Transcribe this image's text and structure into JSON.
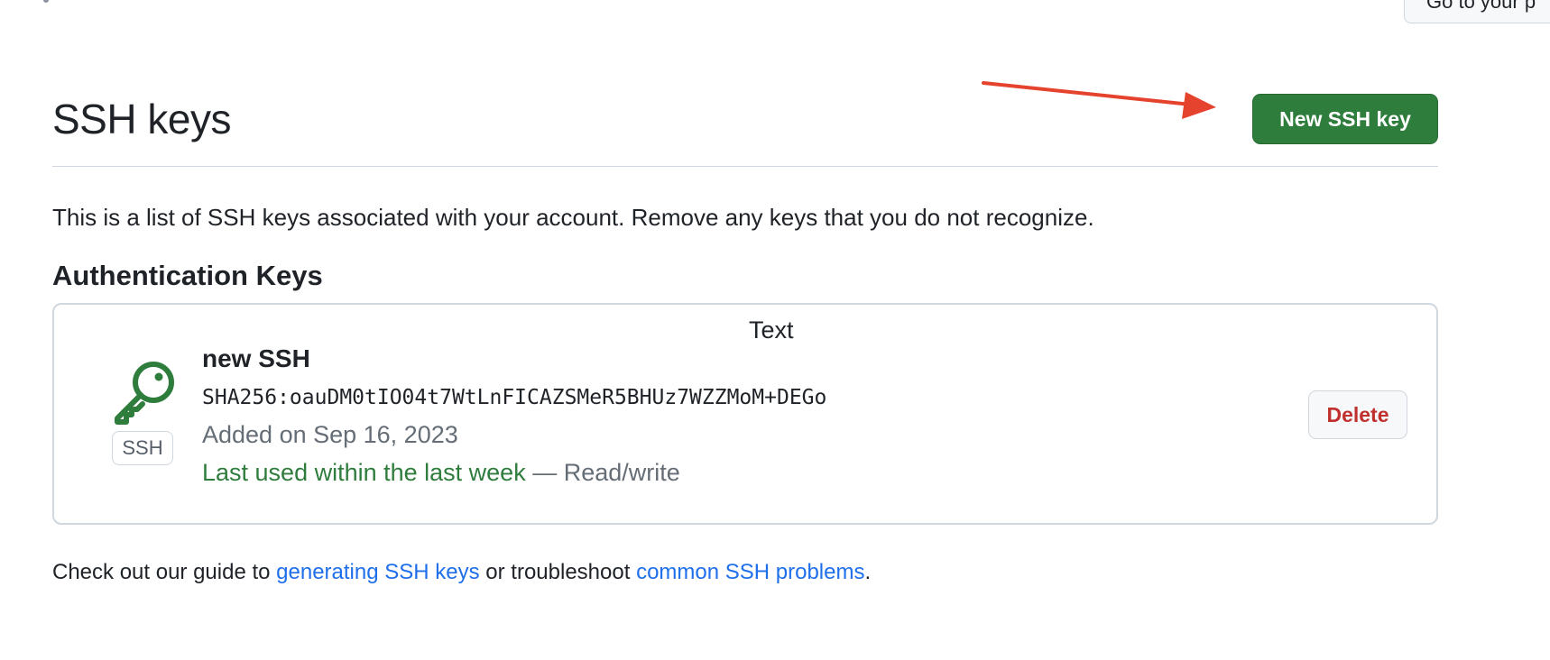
{
  "top": {
    "partial_button_label": "Go to your p"
  },
  "header": {
    "title": "SSH keys",
    "new_key_button": "New SSH key"
  },
  "description": "This is a list of SSH keys associated with your account. Remove any keys that you do not recognize.",
  "section": {
    "title": "Authentication Keys"
  },
  "overlay_text": "Text",
  "key": {
    "icon": "key-icon",
    "badge": "SSH",
    "name": "new SSH",
    "fingerprint": "SHA256:oauDM0tIO04t7WtLnFICAZSMeR5BHUz7WZZMoM+DEGo",
    "added": "Added on Sep 16, 2023",
    "last_used": "Last used within the last week",
    "separator": " — ",
    "access": "Read/write",
    "delete_button": "Delete"
  },
  "footer": {
    "prefix": "Check out our guide to ",
    "link1": "generating SSH keys",
    "middle": " or troubleshoot ",
    "link2": "common SSH problems",
    "suffix": "."
  },
  "colors": {
    "primary_button": "#2f7d3d",
    "danger_text": "#c0302d",
    "link": "#1f6feb",
    "annotation_arrow": "#e5432d",
    "muted_text": "#656d76"
  }
}
